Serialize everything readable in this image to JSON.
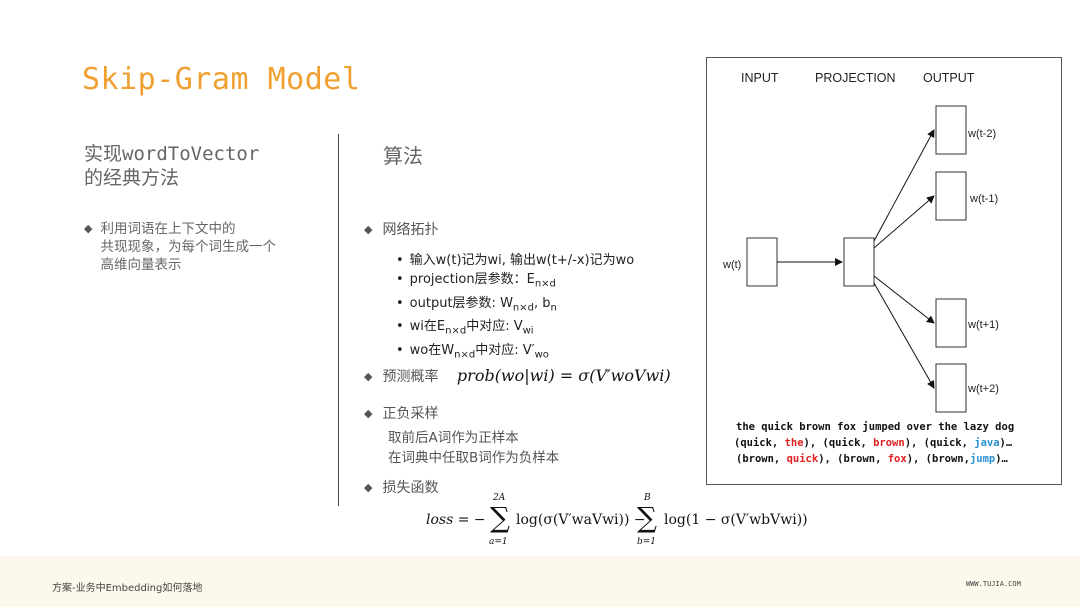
{
  "title": "Skip-Gram Model",
  "subtitle": {
    "line1_prefix": "实现",
    "line1_code": "wordToVector",
    "line2": "的经典方法"
  },
  "left_bullet": {
    "line1": "利用词语在上下文中的",
    "line2": "共现现象，为每个词生成一个",
    "line3": "高维向量表示"
  },
  "algorithm_heading": "算法",
  "sections": {
    "topology": {
      "label": "网络拓扑",
      "items": [
        "输入w(t)记为wi, 输出w(t+/-x)记为wo",
        "projection层参数：E",
        "output层参数: W",
        "wi在E",
        "wo在W"
      ],
      "item_parts": {
        "proj_sub": "n×d",
        "out_sub": "n×d",
        "out_tail": ", b",
        "out_tail_sub": "n",
        "wi_sub": "n×d",
        "wi_tail": "中对应: V",
        "wi_tail_sub": "wi",
        "wo_sub": "n×d",
        "wo_tail": "中对应: V′",
        "wo_tail_sub": "wo"
      }
    },
    "probability": {
      "label": "预测概率",
      "formula": "prob(wo|wi) = σ(V′woVwi)"
    },
    "sampling": {
      "label": "正负采样",
      "line1": "取前后A词作为正样本",
      "line2": "在词典中任取B词作为负样本"
    },
    "loss": {
      "label": "损失函数",
      "lhs": "loss = −",
      "sum1_top": "2A",
      "sum1_bottom": "a=1",
      "term1": "log(σ(V′waVwi)) −",
      "sum2_top": "B",
      "sum2_bottom": "b=1",
      "term2": "log(1 − σ(V′wbVwi))"
    }
  },
  "diagram": {
    "headers": [
      "INPUT",
      "PROJECTION",
      "OUTPUT"
    ],
    "input_label": "w(t)",
    "output_labels": [
      "w(t-2)",
      "w(t-1)",
      "w(t+1)",
      "w(t+2)"
    ],
    "sentence": "the quick brown fox jumped over the lazy dog",
    "pairs_line1": [
      {
        "a": "(quick, ",
        "b": "the",
        "c": "), ",
        "color": "red"
      },
      {
        "a": "(quick, ",
        "b": "brown",
        "c": "), ",
        "color": "red"
      },
      {
        "a": "(quick, ",
        "b": "java",
        "c": ")…",
        "color": "blue"
      }
    ],
    "pairs_line2": [
      {
        "a": "(brown, ",
        "b": "quick",
        "c": "), ",
        "color": "red"
      },
      {
        "a": "(brown, ",
        "b": "fox",
        "c": "), ",
        "color": "red"
      },
      {
        "a": "(brown,",
        "b": "jump",
        "c": ")…",
        "color": "blue"
      }
    ],
    "colors": {
      "positive": "#e02020",
      "negative": "#2a8fd0"
    }
  },
  "footer": {
    "left": "方案-业务中Embedding如何落地",
    "right": "WWW.TUJIA.COM"
  },
  "colors": {
    "title": "#f0a030",
    "footer_bg": "#fdf8ec"
  }
}
